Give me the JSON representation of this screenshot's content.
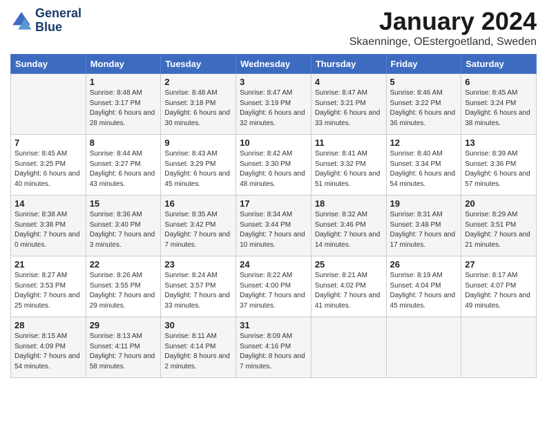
{
  "header": {
    "logo_line1": "General",
    "logo_line2": "Blue",
    "month": "January 2024",
    "location": "Skaenninge, OEstergoetland, Sweden"
  },
  "days_of_week": [
    "Sunday",
    "Monday",
    "Tuesday",
    "Wednesday",
    "Thursday",
    "Friday",
    "Saturday"
  ],
  "weeks": [
    [
      {
        "day": "",
        "sunrise": "",
        "sunset": "",
        "daylight": ""
      },
      {
        "day": "1",
        "sunrise": "Sunrise: 8:48 AM",
        "sunset": "Sunset: 3:17 PM",
        "daylight": "Daylight: 6 hours and 28 minutes."
      },
      {
        "day": "2",
        "sunrise": "Sunrise: 8:48 AM",
        "sunset": "Sunset: 3:18 PM",
        "daylight": "Daylight: 6 hours and 30 minutes."
      },
      {
        "day": "3",
        "sunrise": "Sunrise: 8:47 AM",
        "sunset": "Sunset: 3:19 PM",
        "daylight": "Daylight: 6 hours and 32 minutes."
      },
      {
        "day": "4",
        "sunrise": "Sunrise: 8:47 AM",
        "sunset": "Sunset: 3:21 PM",
        "daylight": "Daylight: 6 hours and 33 minutes."
      },
      {
        "day": "5",
        "sunrise": "Sunrise: 8:46 AM",
        "sunset": "Sunset: 3:22 PM",
        "daylight": "Daylight: 6 hours and 36 minutes."
      },
      {
        "day": "6",
        "sunrise": "Sunrise: 8:45 AM",
        "sunset": "Sunset: 3:24 PM",
        "daylight": "Daylight: 6 hours and 38 minutes."
      }
    ],
    [
      {
        "day": "7",
        "sunrise": "Sunrise: 8:45 AM",
        "sunset": "Sunset: 3:25 PM",
        "daylight": "Daylight: 6 hours and 40 minutes."
      },
      {
        "day": "8",
        "sunrise": "Sunrise: 8:44 AM",
        "sunset": "Sunset: 3:27 PM",
        "daylight": "Daylight: 6 hours and 43 minutes."
      },
      {
        "day": "9",
        "sunrise": "Sunrise: 8:43 AM",
        "sunset": "Sunset: 3:29 PM",
        "daylight": "Daylight: 6 hours and 45 minutes."
      },
      {
        "day": "10",
        "sunrise": "Sunrise: 8:42 AM",
        "sunset": "Sunset: 3:30 PM",
        "daylight": "Daylight: 6 hours and 48 minutes."
      },
      {
        "day": "11",
        "sunrise": "Sunrise: 8:41 AM",
        "sunset": "Sunset: 3:32 PM",
        "daylight": "Daylight: 6 hours and 51 minutes."
      },
      {
        "day": "12",
        "sunrise": "Sunrise: 8:40 AM",
        "sunset": "Sunset: 3:34 PM",
        "daylight": "Daylight: 6 hours and 54 minutes."
      },
      {
        "day": "13",
        "sunrise": "Sunrise: 8:39 AM",
        "sunset": "Sunset: 3:36 PM",
        "daylight": "Daylight: 6 hours and 57 minutes."
      }
    ],
    [
      {
        "day": "14",
        "sunrise": "Sunrise: 8:38 AM",
        "sunset": "Sunset: 3:38 PM",
        "daylight": "Daylight: 7 hours and 0 minutes."
      },
      {
        "day": "15",
        "sunrise": "Sunrise: 8:36 AM",
        "sunset": "Sunset: 3:40 PM",
        "daylight": "Daylight: 7 hours and 3 minutes."
      },
      {
        "day": "16",
        "sunrise": "Sunrise: 8:35 AM",
        "sunset": "Sunset: 3:42 PM",
        "daylight": "Daylight: 7 hours and 7 minutes."
      },
      {
        "day": "17",
        "sunrise": "Sunrise: 8:34 AM",
        "sunset": "Sunset: 3:44 PM",
        "daylight": "Daylight: 7 hours and 10 minutes."
      },
      {
        "day": "18",
        "sunrise": "Sunrise: 8:32 AM",
        "sunset": "Sunset: 3:46 PM",
        "daylight": "Daylight: 7 hours and 14 minutes."
      },
      {
        "day": "19",
        "sunrise": "Sunrise: 8:31 AM",
        "sunset": "Sunset: 3:48 PM",
        "daylight": "Daylight: 7 hours and 17 minutes."
      },
      {
        "day": "20",
        "sunrise": "Sunrise: 8:29 AM",
        "sunset": "Sunset: 3:51 PM",
        "daylight": "Daylight: 7 hours and 21 minutes."
      }
    ],
    [
      {
        "day": "21",
        "sunrise": "Sunrise: 8:27 AM",
        "sunset": "Sunset: 3:53 PM",
        "daylight": "Daylight: 7 hours and 25 minutes."
      },
      {
        "day": "22",
        "sunrise": "Sunrise: 8:26 AM",
        "sunset": "Sunset: 3:55 PM",
        "daylight": "Daylight: 7 hours and 29 minutes."
      },
      {
        "day": "23",
        "sunrise": "Sunrise: 8:24 AM",
        "sunset": "Sunset: 3:57 PM",
        "daylight": "Daylight: 7 hours and 33 minutes."
      },
      {
        "day": "24",
        "sunrise": "Sunrise: 8:22 AM",
        "sunset": "Sunset: 4:00 PM",
        "daylight": "Daylight: 7 hours and 37 minutes."
      },
      {
        "day": "25",
        "sunrise": "Sunrise: 8:21 AM",
        "sunset": "Sunset: 4:02 PM",
        "daylight": "Daylight: 7 hours and 41 minutes."
      },
      {
        "day": "26",
        "sunrise": "Sunrise: 8:19 AM",
        "sunset": "Sunset: 4:04 PM",
        "daylight": "Daylight: 7 hours and 45 minutes."
      },
      {
        "day": "27",
        "sunrise": "Sunrise: 8:17 AM",
        "sunset": "Sunset: 4:07 PM",
        "daylight": "Daylight: 7 hours and 49 minutes."
      }
    ],
    [
      {
        "day": "28",
        "sunrise": "Sunrise: 8:15 AM",
        "sunset": "Sunset: 4:09 PM",
        "daylight": "Daylight: 7 hours and 54 minutes."
      },
      {
        "day": "29",
        "sunrise": "Sunrise: 8:13 AM",
        "sunset": "Sunset: 4:11 PM",
        "daylight": "Daylight: 7 hours and 58 minutes."
      },
      {
        "day": "30",
        "sunrise": "Sunrise: 8:11 AM",
        "sunset": "Sunset: 4:14 PM",
        "daylight": "Daylight: 8 hours and 2 minutes."
      },
      {
        "day": "31",
        "sunrise": "Sunrise: 8:09 AM",
        "sunset": "Sunset: 4:16 PM",
        "daylight": "Daylight: 8 hours and 7 minutes."
      },
      {
        "day": "",
        "sunrise": "",
        "sunset": "",
        "daylight": ""
      },
      {
        "day": "",
        "sunrise": "",
        "sunset": "",
        "daylight": ""
      },
      {
        "day": "",
        "sunrise": "",
        "sunset": "",
        "daylight": ""
      }
    ]
  ]
}
